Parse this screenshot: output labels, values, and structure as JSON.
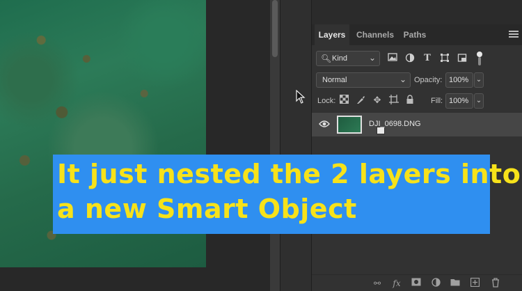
{
  "caption": {
    "line1": "It just nested the 2 layers into",
    "line2": "a new Smart Object",
    "text_color": "#f7e21a",
    "background": "#2f8ff0"
  },
  "panel": {
    "tabs": [
      {
        "label": "Layers",
        "active": true
      },
      {
        "label": "Channels",
        "active": false
      },
      {
        "label": "Paths",
        "active": false
      }
    ],
    "filter": {
      "kind_label": "Kind"
    },
    "blend_mode": "Normal",
    "opacity": {
      "label": "Opacity:",
      "value": "100%"
    },
    "lock": {
      "label": "Lock:"
    },
    "fill": {
      "label": "Fill:",
      "value": "100%"
    },
    "layers": [
      {
        "name": "DJI_0698.DNG",
        "visible": true,
        "smart_object": true
      }
    ]
  },
  "icons": {
    "filter": [
      "search-icon",
      "image-filter-icon",
      "adjustment-filter-icon",
      "type-filter-icon",
      "shape-filter-icon",
      "smart-object-filter-icon"
    ],
    "lock": [
      "lock-transparent-pixels-icon",
      "lock-image-pixels-icon",
      "lock-position-icon",
      "lock-artboard-icon",
      "lock-all-icon"
    ],
    "bottom": [
      "link-layers-icon",
      "layer-style-icon",
      "add-mask-icon",
      "adjustment-layer-icon",
      "new-group-icon",
      "new-layer-icon",
      "delete-layer-icon"
    ]
  }
}
